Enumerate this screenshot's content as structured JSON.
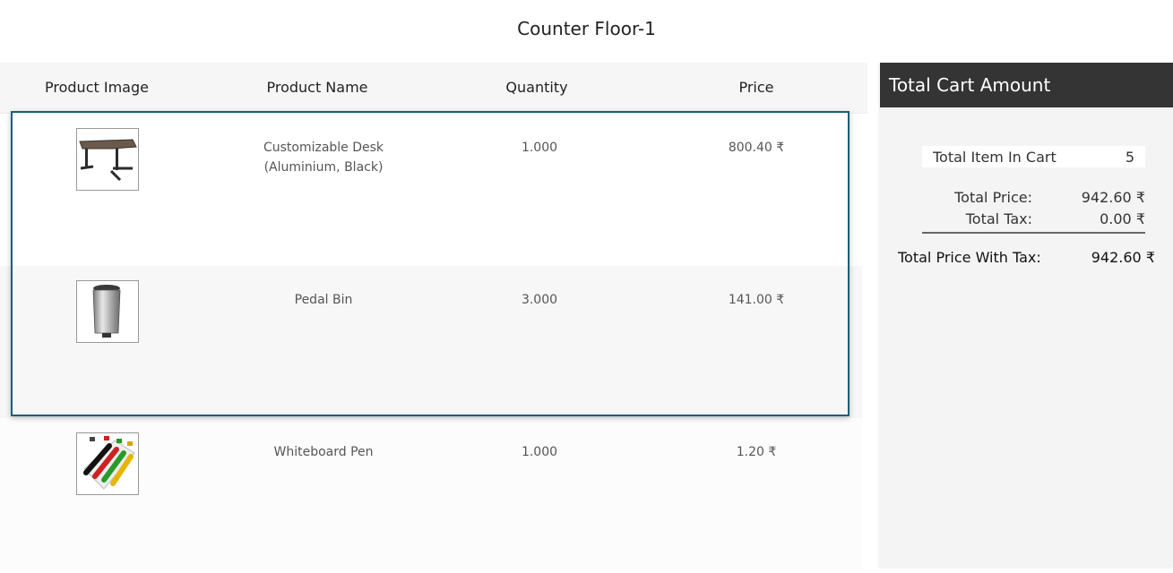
{
  "page_title": "Counter Floor-1",
  "table": {
    "columns": [
      "Product Image",
      "Product Name",
      "Quantity",
      "Price"
    ],
    "rows": [
      {
        "name_line1": "Customizable Desk",
        "name_line2": "(Aluminium, Black)",
        "quantity": "1.000",
        "price": "800.40 ₹",
        "image_icon": "desk-image"
      },
      {
        "name_line1": "Pedal Bin",
        "name_line2": "",
        "quantity": "3.000",
        "price": "141.00 ₹",
        "image_icon": "pedal-bin-image"
      },
      {
        "name_line1": "Whiteboard Pen",
        "name_line2": "",
        "quantity": "1.000",
        "price": "1.20 ₹",
        "image_icon": "whiteboard-pens-image"
      }
    ]
  },
  "summary": {
    "title": "Total Cart Amount",
    "items_label": "Total Item In Cart",
    "items_count": "5",
    "price_label": "Total Price:",
    "price_value": "942.60 ₹",
    "tax_label": "Total Tax:",
    "tax_value": "0.00 ₹",
    "total_label": "Total Price With Tax:",
    "total_value": "942.60 ₹"
  },
  "colors": {
    "summary_header": "#343434",
    "selection_border": "#1f5d7a"
  }
}
